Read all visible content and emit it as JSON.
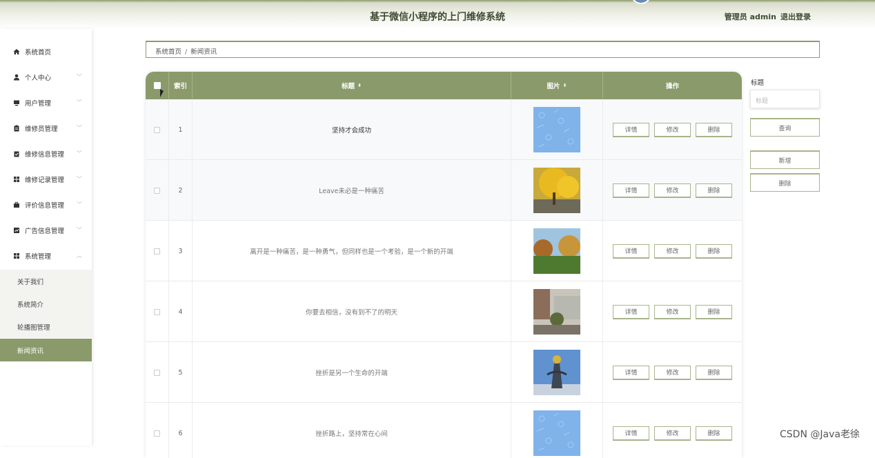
{
  "header": {
    "title": "基于微信小程序的上门维修系统",
    "user_label": "管理员 admin",
    "logout": "退出登录"
  },
  "sidebar": {
    "items": [
      {
        "label": "系统首页",
        "icon": "home-icon"
      },
      {
        "label": "个人中心",
        "icon": "user-icon"
      },
      {
        "label": "用户管理",
        "icon": "monitor-icon"
      },
      {
        "label": "维修员管理",
        "icon": "clipboard-icon"
      },
      {
        "label": "维修信息管理",
        "icon": "clipboard-check-icon"
      },
      {
        "label": "维修记录管理",
        "icon": "grid-icon"
      },
      {
        "label": "评价信息管理",
        "icon": "briefcase-icon"
      },
      {
        "label": "广告信息管理",
        "icon": "chart-icon"
      },
      {
        "label": "系统管理",
        "icon": "grid-icon"
      }
    ],
    "subitems": [
      {
        "label": "关于我们"
      },
      {
        "label": "系统简介"
      },
      {
        "label": "轮播图管理"
      },
      {
        "label": "新闻资讯"
      }
    ]
  },
  "breadcrumb": {
    "home": "系统首页",
    "separator": "/",
    "current": "新闻资讯"
  },
  "table": {
    "headers": {
      "index": "索引",
      "title": "标题",
      "image": "图片",
      "ops": "操作"
    },
    "buttons": {
      "detail": "详情",
      "edit": "修改",
      "delete": "删除"
    },
    "rows": [
      {
        "index": "1",
        "title": "坚持才会成功"
      },
      {
        "index": "2",
        "title": "Leave未必是一种痛苦"
      },
      {
        "index": "3",
        "title": "离开是一种痛苦，是一种勇气，但同样也是一个考验，是一个新的开端"
      },
      {
        "index": "4",
        "title": "你要去相信，没有到不了的明天"
      },
      {
        "index": "5",
        "title": "挫折是另一个生命的开端"
      },
      {
        "index": "6",
        "title": "挫折路上，坚持常在心间"
      }
    ]
  },
  "search": {
    "label": "标题",
    "placeholder": "标题",
    "query_button": "查询",
    "add_button": "新增",
    "delete_button": "删除"
  },
  "watermark": "CSDN @Java老徐",
  "colors": {
    "accent": "#8b9a6b",
    "header_text": "#3e4a33"
  }
}
